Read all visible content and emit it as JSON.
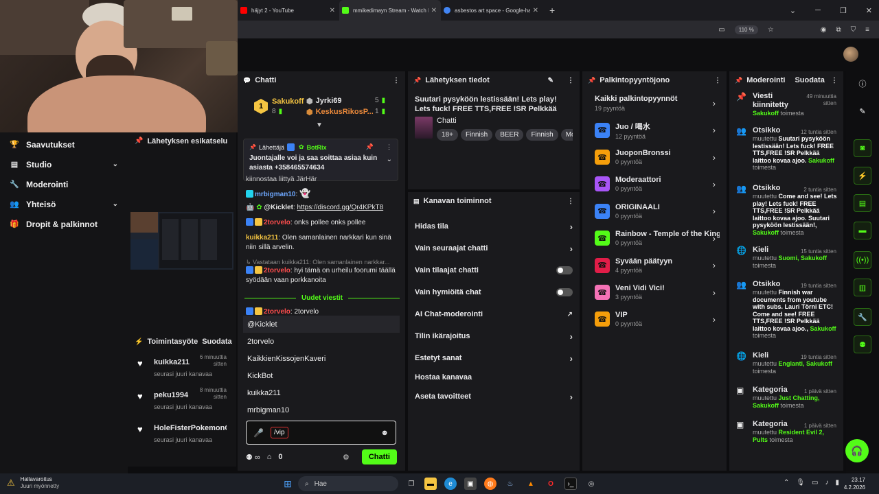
{
  "browser": {
    "tabs": [
      {
        "title": "häjyt 2 - YouTube",
        "color": "#ff0000"
      },
      {
        "title": "mmikedimayn Stream - Watch Li",
        "color": "#53fc18"
      },
      {
        "title": "asbestos art space - Google-ha",
        "color": "#4285f4"
      }
    ],
    "new_tab": "+",
    "zoom": "110 %"
  },
  "left_nav": {
    "items": [
      {
        "label": "Saavutukset",
        "icon": "trophy-icon",
        "glyph": "🏆",
        "chevron": false
      },
      {
        "label": "Studio",
        "icon": "studio-icon",
        "glyph": "▤",
        "chevron": true
      },
      {
        "label": "Moderointi",
        "icon": "wrench-icon",
        "glyph": "🔧",
        "chevron": false
      },
      {
        "label": "Yhteisö",
        "icon": "community-icon",
        "glyph": "👥",
        "chevron": true
      },
      {
        "label": "Dropit & palkinnot",
        "icon": "gift-icon",
        "glyph": "🎁",
        "chevron": false
      }
    ]
  },
  "preview": {
    "title": "Lähetyksen esikatselu"
  },
  "activity": {
    "title": "Toimintasyöte",
    "filter": "Suodata",
    "items": [
      {
        "name": "kuikka211",
        "time": "6 minuuttia sitten",
        "sub": "seurasi juuri kanavaa"
      },
      {
        "name": "peku1994",
        "time": "8 minuuttia sitten",
        "sub": "seurasi juuri kanavaa"
      },
      {
        "name": "HoleFisterPokemonGo",
        "time": "",
        "sub": "seurasi juuri kanavaa"
      }
    ]
  },
  "chat": {
    "title": "Chatti",
    "leaderboard": {
      "first": {
        "name": "Sakukoff",
        "count": "8",
        "rank": "1"
      },
      "second": {
        "name": "Jyrki69",
        "count": "5"
      },
      "third": {
        "name": "KeskusRikosP...",
        "count": "1"
      }
    },
    "pinned": {
      "label": "Lähettäjä",
      "user": "BotRix",
      "text": "Juontajalle voi ja saa soittaa asiaa kuin asiasta +358465574634"
    },
    "messages": {
      "m0": "kiinnostaa liittyä JärHär",
      "m1_user": "mrbigman10",
      "m1_text": ": ",
      "m2_user": "@Kicklet",
      "m2_text": ": ",
      "m2_link": "https://discord.gg/Qr4KPkT8",
      "m3_user": "2torvelo",
      "m3_text": ": onks pollee onks pollee",
      "m4_user": "kuikka211",
      "m4_text": ": Olen samanlainen narkkari kun sinä niin sillä arvelin.",
      "m5_reply": "Vastataan kuikka211: Olen samanlainen narkkar...",
      "m5_user": "2torvelo",
      "m5_text": ": hyi tämä on urheilu foorumi täällä syödään vaan porkkanoita",
      "m6_user": "2torvelo",
      "m6_text": ": 2torvelo"
    },
    "new_messages": "Uudet viestit",
    "suggestions": [
      "@Kicklet",
      "2torvelo",
      "KaikkienKissojenKaveri",
      "KickBot",
      "kuikka211",
      "mrbigman10"
    ],
    "input_command": "/vip",
    "footer_count": "0",
    "send_label": "Chatti"
  },
  "stream_info": {
    "title": "Lähetyksen tiedot",
    "stream_title": "Suutari pysyköön lestissään! Lets play! Lets fuck! FREE TTS,FREE !SR Pelkkää laittoo kov...",
    "category": "Chatti",
    "tags": [
      "18+",
      "Finnish",
      "BEER",
      "Finnish",
      "Mo"
    ]
  },
  "channel_actions": {
    "title": "Kanavan toiminnot",
    "items": [
      {
        "label": "Hidas tila",
        "kind": "chevron"
      },
      {
        "label": "Vain seuraajat chatti",
        "kind": "chevron"
      },
      {
        "label": "Vain tilaajat chatti",
        "kind": "toggle"
      },
      {
        "label": "Vain hymiöitä chat",
        "kind": "toggle"
      },
      {
        "label": "AI Chat-moderointi",
        "kind": "external"
      },
      {
        "label": "Tilin ikärajoitus",
        "kind": "chevron"
      },
      {
        "label": "Estetyt sanat",
        "kind": "chevron"
      },
      {
        "label": "Hostaa kanavaa",
        "kind": "none"
      },
      {
        "label": "Aseta tavoitteet",
        "kind": "chevron"
      }
    ]
  },
  "rewards": {
    "title": "Palkintopyyntöjono",
    "all_label": "Kaikki palkintopyynnöt",
    "all_count": "19 pyyntöä",
    "items": [
      {
        "name": "Juo / 喝水",
        "count": "12 pyyntöä",
        "color": "#3b82f6"
      },
      {
        "name": "JuoponBronssi",
        "count": "0 pyyntöä",
        "color": "#f59e0b"
      },
      {
        "name": "Moderaattori",
        "count": "0 pyyntöä",
        "color": "#a855f7"
      },
      {
        "name": "ORIGINAALI",
        "count": "0 pyyntöä",
        "color": "#3b82f6"
      },
      {
        "name": "Rainbow - Temple of the King",
        "count": "0 pyyntöä",
        "color": "#53fc18"
      },
      {
        "name": "Syvään päätyyn",
        "count": "4 pyyntöä",
        "color": "#e11d48"
      },
      {
        "name": "Veni Vidi Vici!",
        "count": "3 pyyntöä",
        "color": "#f472b6"
      },
      {
        "name": "VIP",
        "count": "0 pyyntöä",
        "color": "#f59e0b"
      }
    ]
  },
  "moderation": {
    "title": "Moderointi",
    "filter": "Suodata",
    "items": [
      {
        "icon": "pin-icon",
        "glyph": "📌",
        "type": "Viesti kiinnitetty",
        "time": "49 minuuttia sitten",
        "verb": "",
        "detail": "",
        "by": "Sakukoff",
        "suffix": " toimesta"
      },
      {
        "icon": "users-icon",
        "glyph": "👥",
        "type": "Otsikko",
        "time": "12 tuntia sitten",
        "verb": "muutettu ",
        "detail": "Suutari pysyköön lestissään! Lets fuck! FREE TTS,FREE !SR Pelkkää laittoo kovaa ajoo.",
        "by": "Sakukoff",
        "suffix": " toimesta"
      },
      {
        "icon": "users-icon",
        "glyph": "👥",
        "type": "Otsikko",
        "time": "2 tuntia sitten",
        "verb": "muutettu ",
        "detail": "Come and see! Lets play! Lets fuck! FREE TTS,FREE !SR Pelkkää laittoo kovaa ajoo. Suutari pysyköön lestissään!,",
        "by": "Sakukoff",
        "suffix": " toimesta"
      },
      {
        "icon": "globe-icon",
        "glyph": "🌐",
        "type": "Kieli",
        "time": "15 tuntia sitten",
        "verb": "muutettu ",
        "detail_green": "Suomi, Sakukoff",
        "suffix": " toimesta"
      },
      {
        "icon": "users-icon",
        "glyph": "👥",
        "type": "Otsikko",
        "time": "19 tuntia sitten",
        "verb": "muutettu ",
        "detail": "Finnish war documents from youtube with subs. Lauri Törni ETC! Come and see! FREE TTS,FREE !SR Pelkkää laittoo kovaa ajoo.,",
        "by": "Sakukoff",
        "suffix": " toimesta"
      },
      {
        "icon": "globe-icon",
        "glyph": "🌐",
        "type": "Kieli",
        "time": "19 tuntia sitten",
        "verb": "muutettu ",
        "detail_green": "Englanti, Sakukoff",
        "suffix": " toimesta"
      },
      {
        "icon": "category-icon",
        "glyph": "▣",
        "type": "Kategoria",
        "time": "1 päivä sitten",
        "verb": "muutettu ",
        "detail_green": "Just Chatting, Sakukoff",
        "suffix": " toimesta"
      },
      {
        "icon": "category-icon",
        "glyph": "▣",
        "type": "Kategoria",
        "time": "1 päivä sitten",
        "verb": "muutettu ",
        "detail_green": "Resident Evil 2, Pults",
        "suffix": " toimesta"
      }
    ]
  },
  "taskbar": {
    "weather_title": "Hallavaroitus",
    "weather_sub": "Juuri myönnetty",
    "search": "Hae",
    "time": "23.17",
    "date": "4.2.2026"
  }
}
